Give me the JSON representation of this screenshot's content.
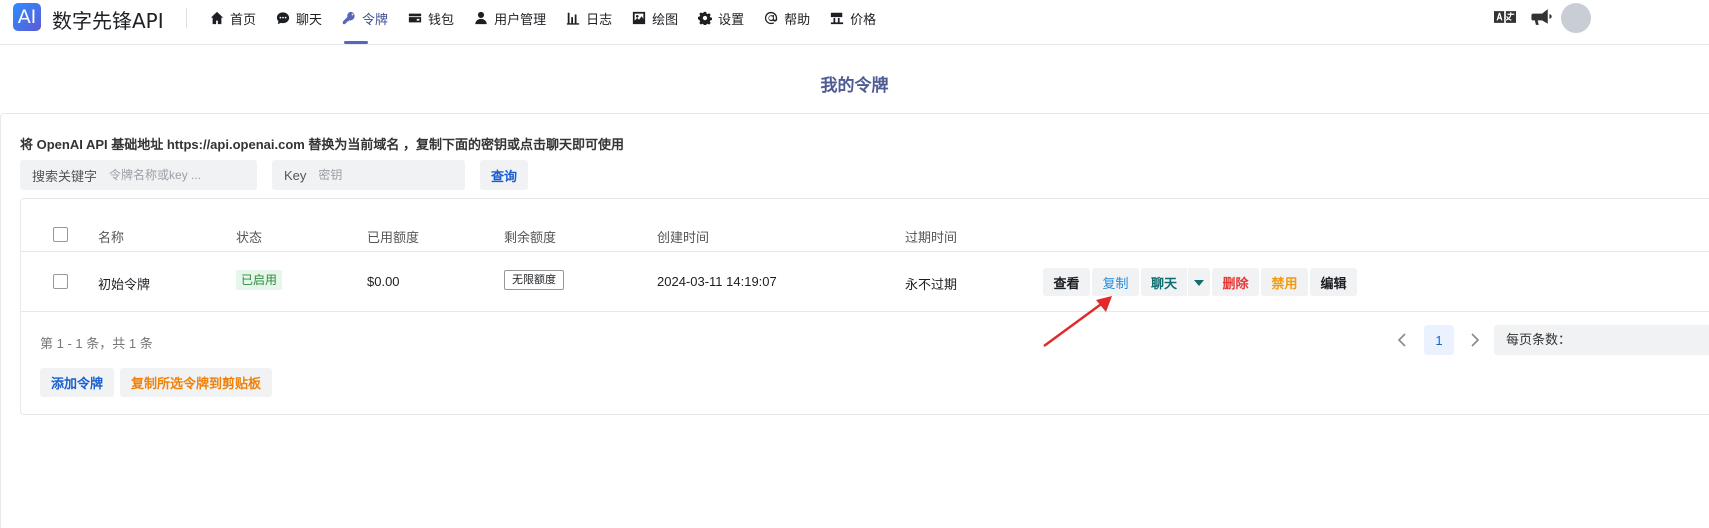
{
  "header": {
    "logo_text": "AI",
    "brand": "数字先锋API",
    "nav": [
      {
        "label": "首页",
        "icon": "home-icon"
      },
      {
        "label": "聊天",
        "icon": "chat-icon"
      },
      {
        "label": "令牌",
        "icon": "key-icon",
        "active": true
      },
      {
        "label": "钱包",
        "icon": "wallet-icon"
      },
      {
        "label": "用户管理",
        "icon": "user-icon"
      },
      {
        "label": "日志",
        "icon": "chart-bar-icon"
      },
      {
        "label": "绘图",
        "icon": "image-icon"
      },
      {
        "label": "设置",
        "icon": "gear-icon"
      },
      {
        "label": "帮助",
        "icon": "at-icon"
      },
      {
        "label": "价格",
        "icon": "price-tag-icon"
      }
    ]
  },
  "page": {
    "title": "我的令牌",
    "hint": "将 OpenAI API 基础地址 https://api.openai.com 替换为当前域名 ，复制下面的密钥或点击聊天即可使用"
  },
  "search": {
    "keyword_label": "搜索关键字",
    "keyword_placeholder": "令牌名称或key ...",
    "key_label": "Key",
    "key_placeholder": "密钥",
    "query_label": "查询"
  },
  "table": {
    "columns": [
      "名称",
      "状态",
      "已用额度",
      "剩余额度",
      "创建时间",
      "过期时间"
    ],
    "rows": [
      {
        "name": "初始令牌",
        "status": "已启用",
        "used": "$0.00",
        "remaining": "无限额度",
        "created": "2024-03-11 14:19:07",
        "expires": "永不过期"
      }
    ],
    "actions": {
      "view": "查看",
      "copy": "复制",
      "chat": "聊天",
      "delete": "删除",
      "disable": "禁用",
      "edit": "编辑"
    }
  },
  "pagination": {
    "summary": "第 1 - 1 条，共 1 条",
    "current_page": "1",
    "per_page_label": "每页条数："
  },
  "footer_buttons": {
    "add": "添加令牌",
    "copy_selected": "复制所选令牌到剪贴板"
  },
  "colors": {
    "accent": "#5865b8",
    "link_blue": "#1a5fd0",
    "copy_blue": "#1f8ce0",
    "chat_teal": "#0f6e6e",
    "delete_red": "#e53935",
    "disable_orange": "#f59a0a",
    "arrow_red": "#e32a2a"
  }
}
